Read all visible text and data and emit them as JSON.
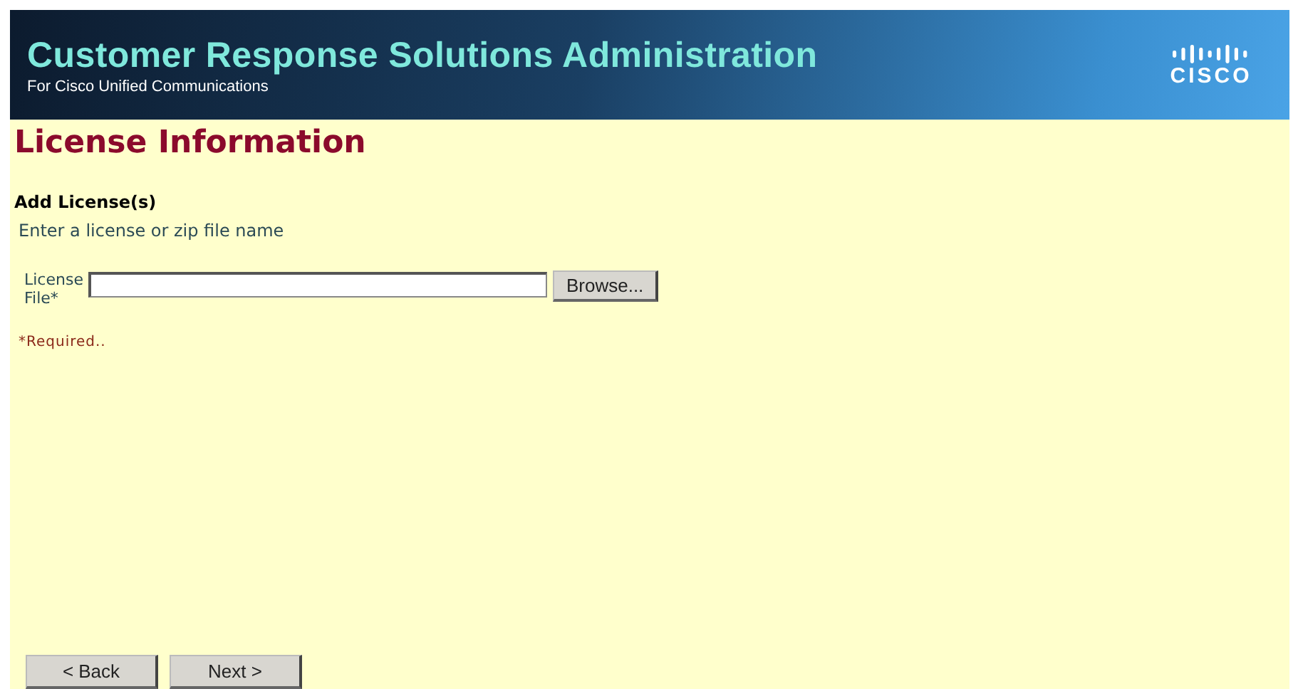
{
  "header": {
    "title": "Customer Response Solutions Administration",
    "subtitle": "For Cisco Unified Communications",
    "logo_text": "CISCO"
  },
  "page_title": "License Information",
  "section_title": "Add License(s)",
  "instructions": "Enter a license or zip file name",
  "form": {
    "label": "License File*",
    "browse_button": "Browse..."
  },
  "required_note": "*Required..",
  "buttons": [
    {
      "label": "< Back"
    },
    {
      "label": "Next >"
    }
  ]
}
